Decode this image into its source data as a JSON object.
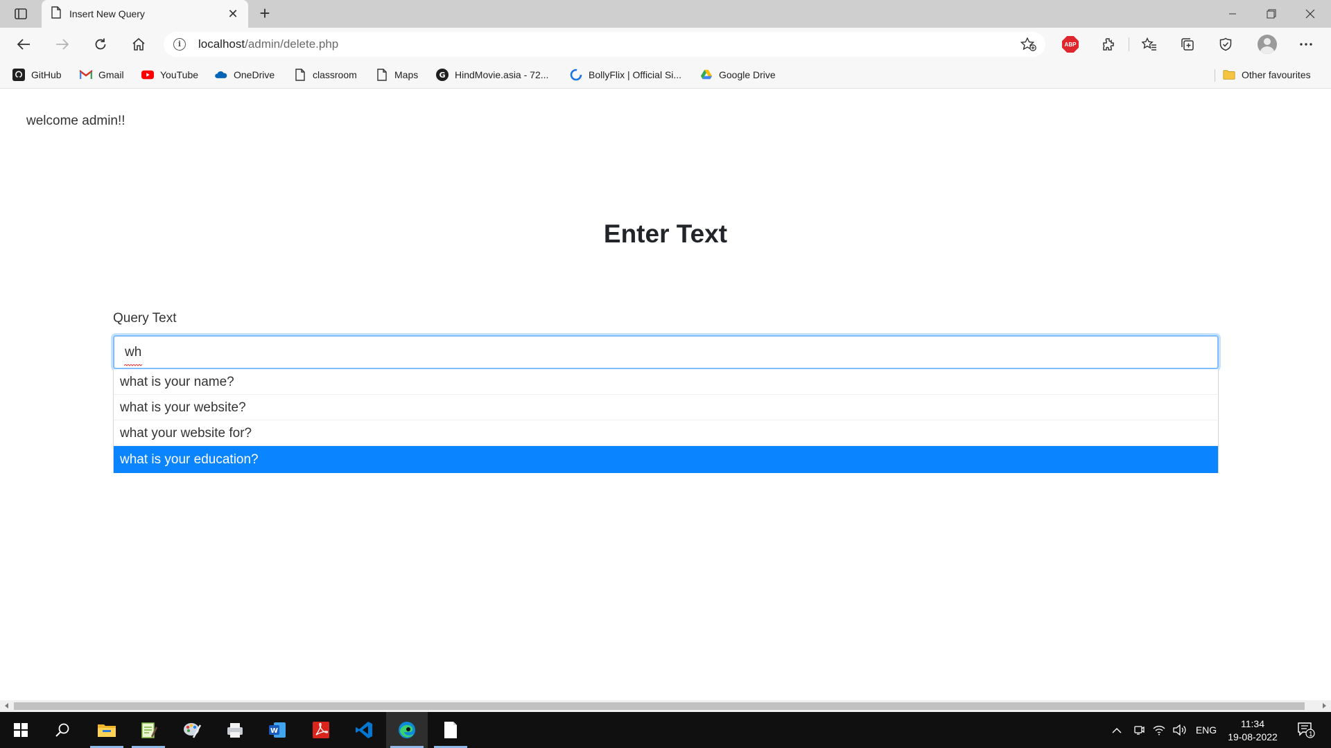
{
  "browser": {
    "tab_title": "Insert New Query",
    "tab_close": "✕",
    "new_tab": "+",
    "url_host": "localhost",
    "url_path": "/admin/delete.php"
  },
  "bookmarks": [
    {
      "label": "GitHub",
      "icon": "github-icon"
    },
    {
      "label": "Gmail",
      "icon": "gmail-icon"
    },
    {
      "label": "YouTube",
      "icon": "youtube-icon"
    },
    {
      "label": "OneDrive",
      "icon": "onedrive-icon"
    },
    {
      "label": "classroom",
      "icon": "page-icon"
    },
    {
      "label": "Maps",
      "icon": "page-icon"
    },
    {
      "label": "HindMovie.asia - 72...",
      "icon": "g-circle-icon"
    },
    {
      "label": "BollyFlix | Official Si...",
      "icon": "bollyflix-icon"
    },
    {
      "label": "Google Drive",
      "icon": "google-drive-icon"
    },
    {
      "label": "Other favourites",
      "icon": "folder-icon"
    }
  ],
  "page": {
    "welcome": "welcome admin!!",
    "heading": "Enter Text",
    "field_label": "Query Text",
    "input_value": "wh",
    "suggestions": [
      "what is your name?",
      "what is your website?",
      "what your website for?",
      "what is your education?"
    ],
    "active_suggestion_index": 3
  },
  "taskbar": {
    "lang": "ENG",
    "time": "11:34",
    "date": "19-08-2022",
    "notification_count": "1"
  },
  "colors": {
    "highlight": "#0a84ff",
    "input_focus": "#80bdff",
    "abp": "#e0262d"
  }
}
